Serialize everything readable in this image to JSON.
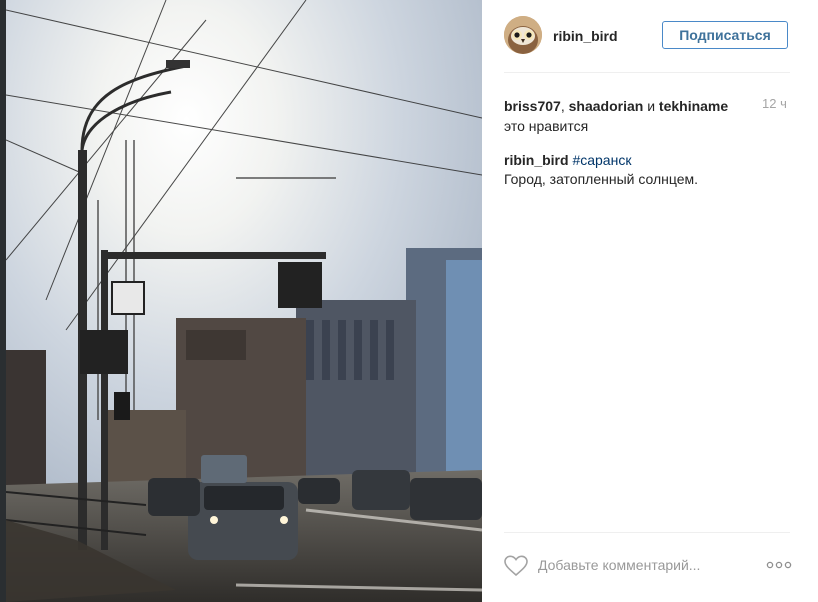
{
  "post": {
    "username": "ribin_bird",
    "follow_label": "Подписаться",
    "likes": {
      "users": [
        "briss707",
        "shaadorian",
        "tekhiname"
      ],
      "sep1": ", ",
      "conj": " и ",
      "suffix": " это нравится"
    },
    "time": "12 ч",
    "caption": {
      "username": "ribin_bird",
      "hashtag": "#саранск",
      "text": "Город, затопленный солнцем."
    },
    "comment": {
      "placeholder": "Добавьте комментарий..."
    }
  },
  "icons": {
    "like": "heart-icon",
    "options": "more-options-icon"
  },
  "colors": {
    "follow_border": "#4a89c8",
    "follow_text": "#3f729b",
    "hashtag": "#003569"
  }
}
